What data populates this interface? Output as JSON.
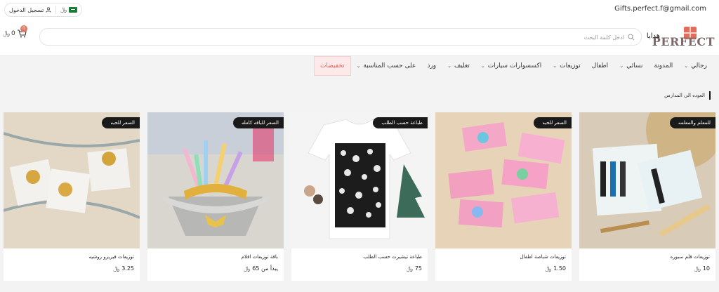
{
  "topbar": {
    "email": "Gifts.perfect.f@gmail.com",
    "login_label": "تسجيل الدخول",
    "currency_symbol": "﷼"
  },
  "header": {
    "logo_text": "PERFECT",
    "gifts_label": "هدايا",
    "search_placeholder": "ادخل كلمة البحث",
    "cart_count": "0",
    "cart_total": "0",
    "currency_symbol": "﷼"
  },
  "nav": {
    "items": [
      {
        "label": "رجالي",
        "has_dropdown": true
      },
      {
        "label": "المدونة",
        "has_dropdown": false
      },
      {
        "label": "نسائي",
        "has_dropdown": true
      },
      {
        "label": "اطفال",
        "has_dropdown": false
      },
      {
        "label": "توزيعات",
        "has_dropdown": true
      },
      {
        "label": "اكسسوارات سيارات",
        "has_dropdown": true
      },
      {
        "label": "تغليف",
        "has_dropdown": true
      },
      {
        "label": "ورد",
        "has_dropdown": false
      },
      {
        "label": "على حسب المناسبة",
        "has_dropdown": true
      },
      {
        "label": "تخفيضات",
        "has_dropdown": false
      }
    ]
  },
  "section": {
    "title": "العوده الي المدارس"
  },
  "products": [
    {
      "tag": "للمعلم والمعلمه",
      "title": "توزيعات قلم سبوره",
      "price": "10",
      "currency": "﷼"
    },
    {
      "tag": "السعر للحبه",
      "title": "توزيعات شباصة اطفال",
      "price": "1.50",
      "currency": "﷼"
    },
    {
      "tag": "طباعة حسب الطلب",
      "title": "طباعة تيشيرت حسب الطلب",
      "price": "75",
      "currency": "﷼"
    },
    {
      "tag": "السعر للباقه كامله",
      "title": "باقة توزيعات اقلام",
      "price": "يبدأ من 65",
      "currency": "﷼"
    },
    {
      "tag": "السعر للحبه",
      "title": "توزيعات فيريرو روشيه",
      "price": "3.25",
      "currency": "﷼"
    }
  ],
  "colors": {
    "sale_bg": "#fde9e9",
    "sale_text": "#e0615a",
    "cart_badge": "#e07762",
    "tag_bg": "#1a1a1a"
  }
}
